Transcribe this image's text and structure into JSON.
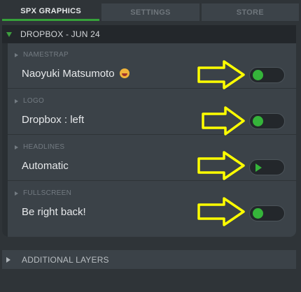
{
  "tabs": [
    {
      "label": "SPX GRAPHICS",
      "active": true
    },
    {
      "label": "SETTINGS",
      "active": false
    },
    {
      "label": "STORE",
      "active": false
    }
  ],
  "rundown": {
    "title": "DROPBOX - JUN 24"
  },
  "items": [
    {
      "category": "NAMESTRAP",
      "text": "Naoyuki Matsumoto",
      "emoji": "grinning-face-emoji",
      "control": "toggle-on"
    },
    {
      "category": "LOGO",
      "text": "Dropbox : left",
      "control": "toggle-on"
    },
    {
      "category": "HEADLINES",
      "text": "Automatic",
      "control": "play"
    },
    {
      "category": "FULLSCREEN",
      "text": "Be right back!",
      "control": "toggle-on"
    }
  ],
  "additional_layers": {
    "label": "ADDITIONAL LAYERS"
  },
  "colors": {
    "accent_green": "#35b43a",
    "highlight_arrow": "#ffff00",
    "panel_bg": "#3b4248",
    "header_bg": "#23272b"
  }
}
